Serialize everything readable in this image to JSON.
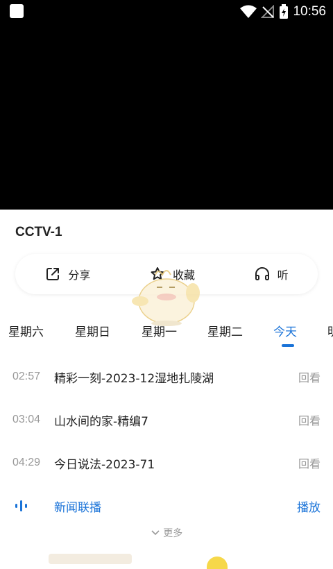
{
  "status_bar": {
    "time": "10:56"
  },
  "channel": {
    "title": "CCTV-1"
  },
  "actions": [
    {
      "label": "分享",
      "icon": "share-icon"
    },
    {
      "label": "收藏",
      "icon": "star-icon"
    },
    {
      "label": "听",
      "icon": "headphones-icon"
    }
  ],
  "days": [
    {
      "label": "星期六"
    },
    {
      "label": "星期日"
    },
    {
      "label": "星期一"
    },
    {
      "label": "星期二"
    },
    {
      "label": "今天"
    },
    {
      "label": "明"
    }
  ],
  "programs": [
    {
      "time": "02:57",
      "name": "精彩一刻-2023-12湿地扎陵湖",
      "action": "回看"
    },
    {
      "time": "03:04",
      "name": "山水间的家-精编7",
      "action": "回看"
    },
    {
      "time": "04:29",
      "name": "今日说法-2023-71",
      "action": "回看"
    }
  ],
  "live": {
    "name": "新闻联播",
    "action": "播放"
  },
  "more_label": "更多",
  "colors": {
    "accent": "#1a73d8",
    "muted": "#999999"
  }
}
